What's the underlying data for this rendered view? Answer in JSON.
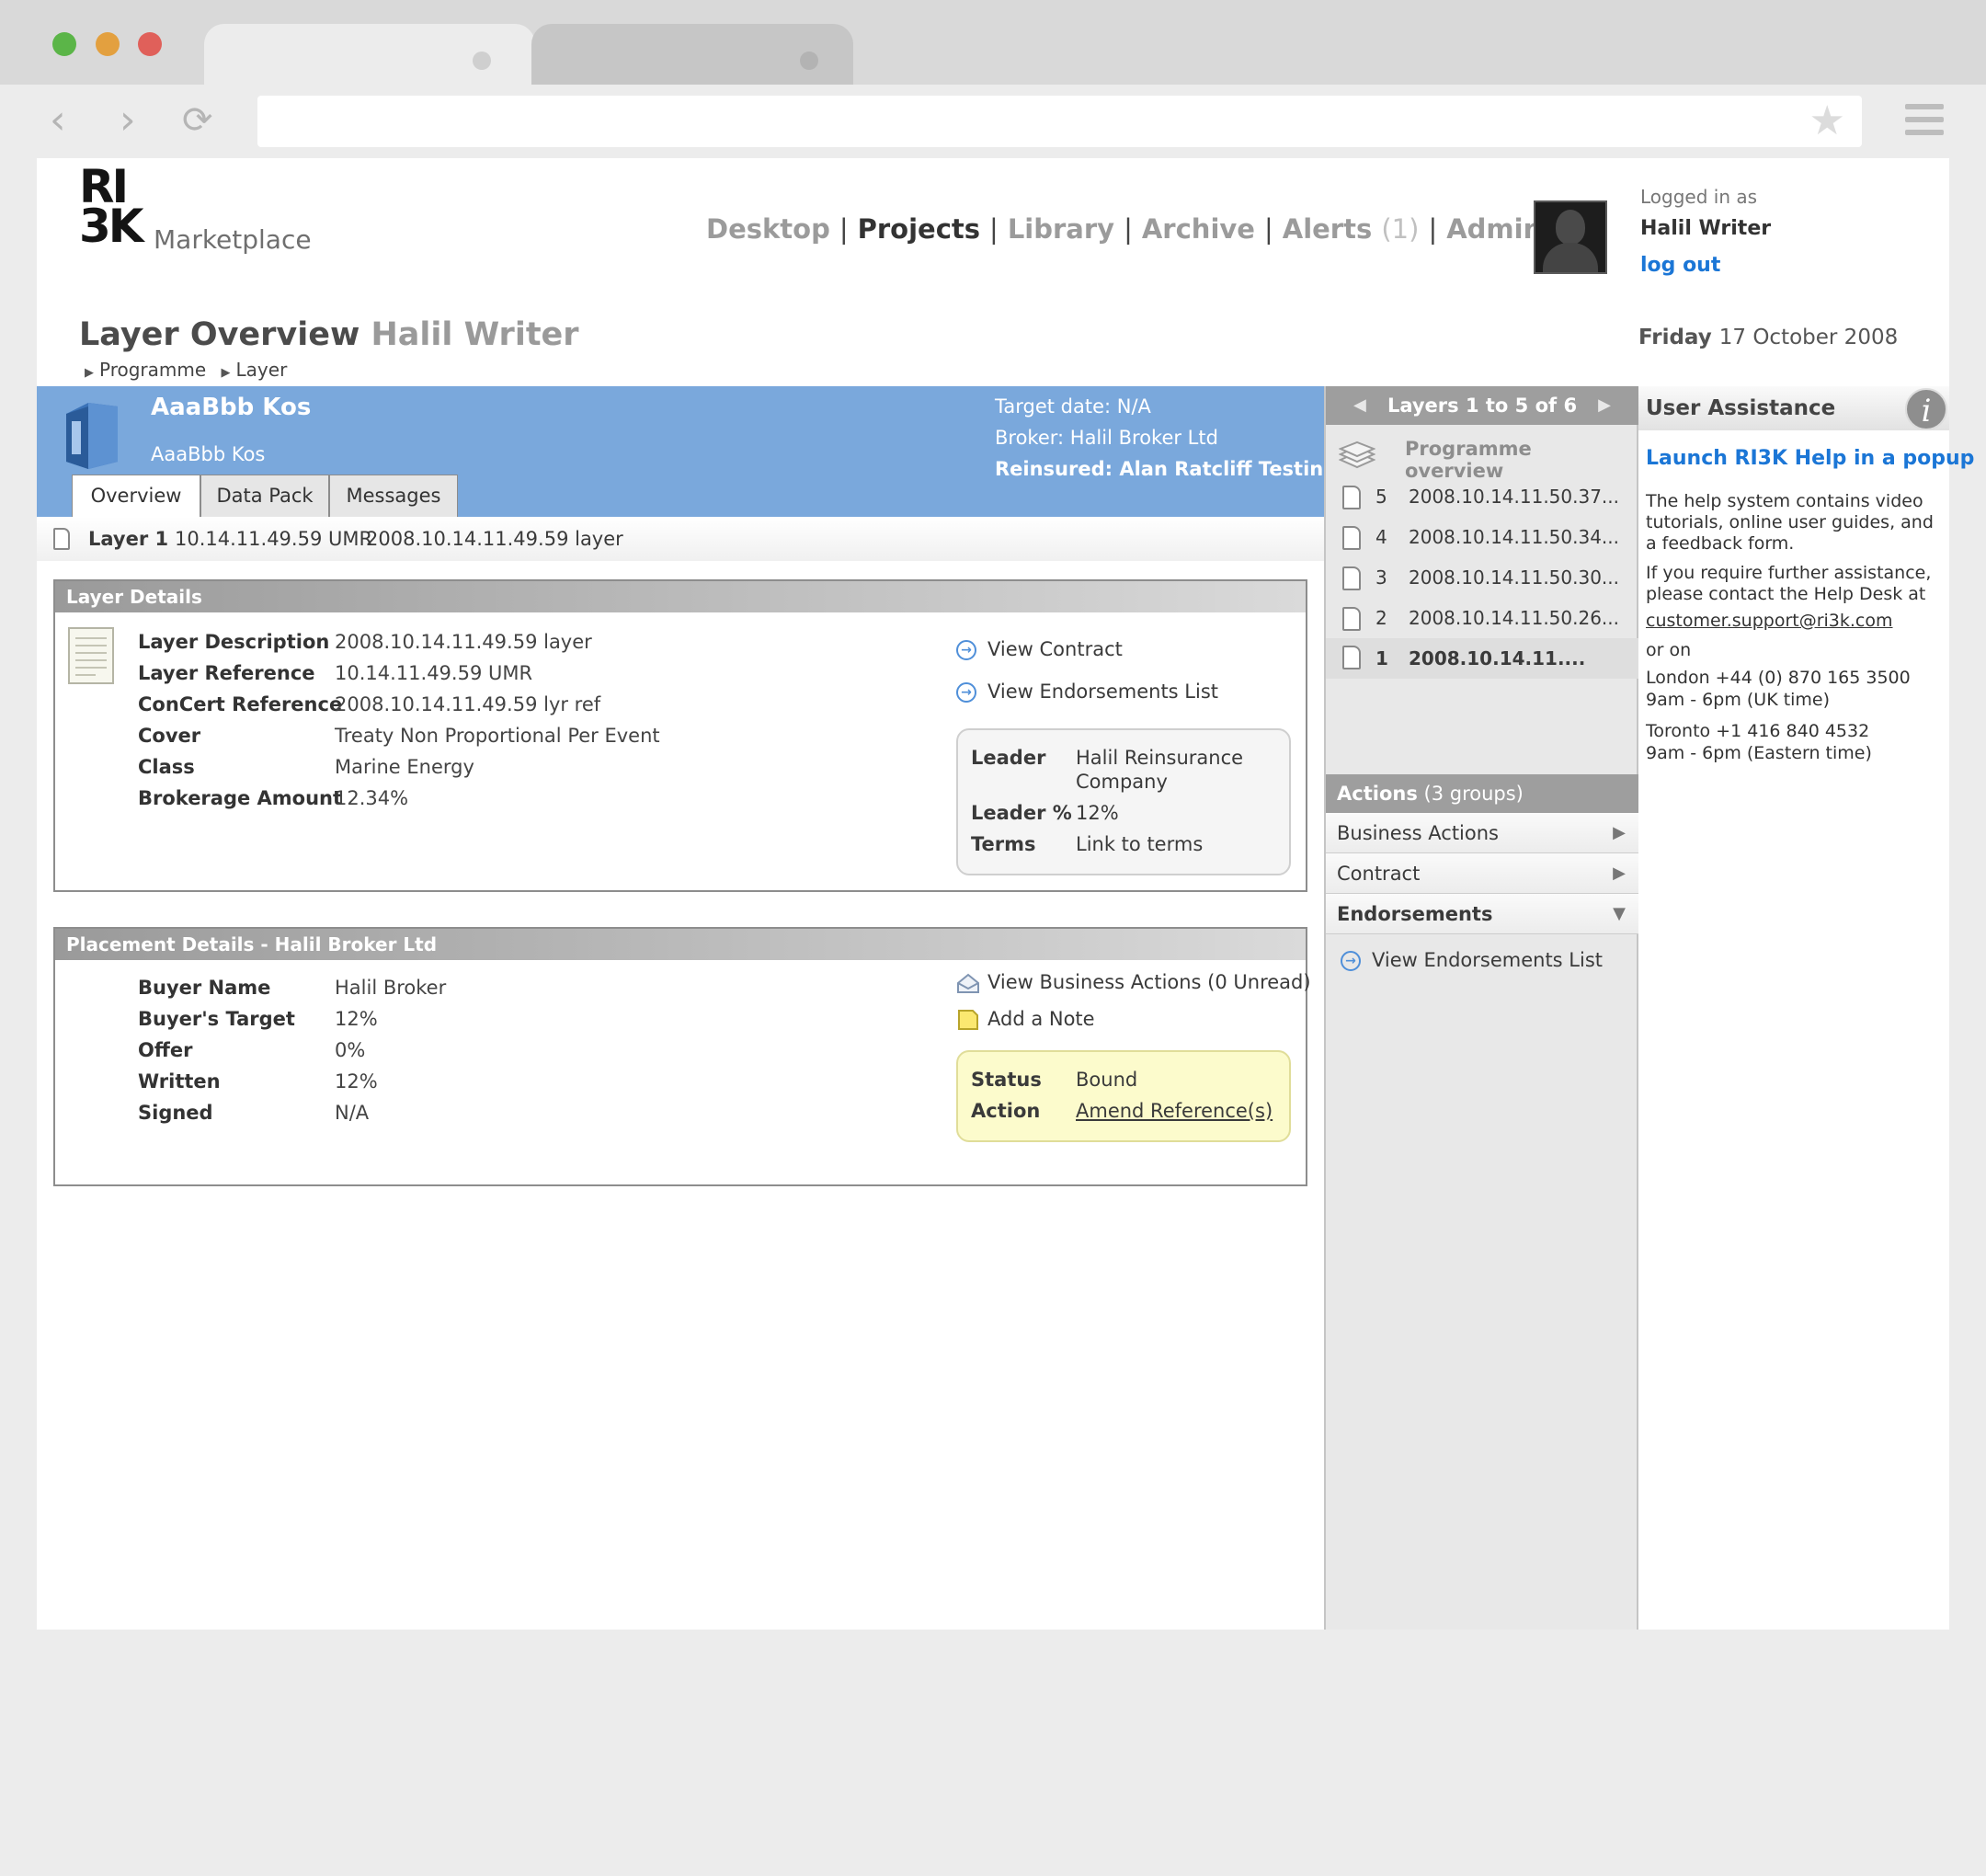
{
  "browser": {
    "window_colors": {
      "close": "#e0605a",
      "minimize": "#e3a03f",
      "maximize": "#5bb548"
    },
    "back_icon": "‹",
    "forward_icon": "›",
    "reload_icon": "⟳",
    "bookmark_icon": "★"
  },
  "header": {
    "logo_top": "RI",
    "logo_bottom": "3K",
    "logo_sub": "Marketplace",
    "nav": [
      {
        "label": "Desktop"
      },
      {
        "label": "Projects"
      },
      {
        "label": "Library"
      },
      {
        "label": "Archive"
      },
      {
        "label": "Alerts",
        "count": "(1)"
      },
      {
        "label": "Admin"
      }
    ],
    "nav_separator": "|",
    "logged_in_as": "Logged in as",
    "user_name": "Halil Writer",
    "logout": "log out"
  },
  "title": {
    "main": "Layer Overview",
    "sub": "Halil Writer",
    "breadcrumb": [
      "Programme",
      "Layer"
    ],
    "day": "Friday",
    "date": "17 October 2008"
  },
  "project": {
    "name": "AaaBbb Kos",
    "subname": "AaaBbb Kos",
    "target_date": "Target date: N/A",
    "broker": "Broker: Halil Broker Ltd",
    "reinsured": "Reinsured: Alan Ratcliff Testing",
    "tabs": [
      "Overview",
      "Data Pack",
      "Messages"
    ]
  },
  "layer_strip": {
    "label": "Layer 1",
    "umr": "10.14.11.49.59 UMR",
    "desc": "2008.10.14.11.49.59 layer"
  },
  "layer_details": {
    "title": "Layer Details",
    "fields": [
      {
        "label": "Layer Description",
        "value": "2008.10.14.11.49.59 layer"
      },
      {
        "label": "Layer Reference",
        "value": "10.14.11.49.59 UMR"
      },
      {
        "label": "ConCert Reference",
        "value": "2008.10.14.11.49.59 lyr ref"
      },
      {
        "label": "Cover",
        "value": "Treaty Non Proportional Per Event"
      },
      {
        "label": "Class",
        "value": "Marine Energy"
      },
      {
        "label": "Brokerage Amount",
        "value": "12.34%"
      }
    ],
    "links": [
      "View Contract",
      "View Endorsements List"
    ],
    "box": [
      {
        "label": "Leader",
        "value": "Halil Reinsurance",
        "value2": "Company"
      },
      {
        "label": "Leader %",
        "value": "12%"
      },
      {
        "label": "Terms",
        "value": "Link to terms"
      }
    ]
  },
  "placement_details": {
    "title": "Placement Details - Halil Broker Ltd",
    "fields": [
      {
        "label": "Buyer Name",
        "value": "Halil Broker"
      },
      {
        "label": "Buyer's Target",
        "value": "12%"
      },
      {
        "label": "Offer",
        "value": "0%"
      },
      {
        "label": "Written",
        "value": "12%"
      },
      {
        "label": "Signed",
        "value": "N/A"
      }
    ],
    "links": [
      "View Business Actions (0 Unread)",
      "Add a Note"
    ],
    "box": [
      {
        "label": "Status",
        "value": "Bound"
      },
      {
        "label": "Action",
        "value": "Amend Reference(s)"
      }
    ]
  },
  "layers": {
    "header": "Layers 1 to 5 of 6",
    "programme_overview": "Programme overview",
    "items": [
      {
        "n": "5",
        "text": "2008.10.14.11.50.37..."
      },
      {
        "n": "4",
        "text": "2008.10.14.11.50.34..."
      },
      {
        "n": "3",
        "text": "2008.10.14.11.50.30..."
      },
      {
        "n": "2",
        "text": "2008.10.14.11.50.26..."
      },
      {
        "n": "1",
        "text": "2008.10.14.11...."
      }
    ]
  },
  "actions": {
    "header_bold": "Actions",
    "header_rest": "(3 groups)",
    "groups": [
      "Business Actions",
      "Contract",
      "Endorsements"
    ],
    "endorsement_link": "View Endorsements List"
  },
  "assistance": {
    "title": "User Assistance",
    "info_icon": "i",
    "help_link": "Launch RI3K Help in a popup",
    "p1": "The help system contains video tutorials, online user guides, and a feedback form.",
    "p2": "If you require further assistance, please contact the Help Desk at",
    "email": "customer.support@ri3k.com",
    "or_on": "or on",
    "london": "London +44 (0) 870 165 3500",
    "london_hours": "9am - 6pm (UK time)",
    "toronto": "Toronto +1 416 840 4532",
    "toronto_hours": "9am - 6pm (Eastern time)"
  }
}
